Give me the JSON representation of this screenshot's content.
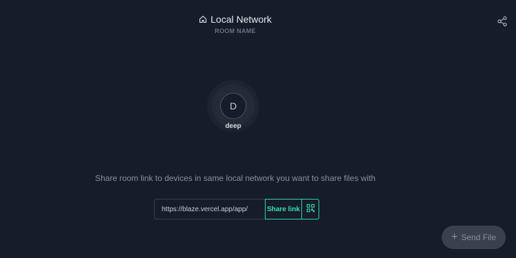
{
  "room": {
    "title": "Local Network",
    "caption": "ROOM NAME",
    "icon": "home-icon"
  },
  "header": {
    "share_icon": "share-icon"
  },
  "peers": [
    {
      "initial": "D",
      "name": "deep"
    }
  ],
  "share": {
    "hint": "Share room link to devices in same local network you want to share files with",
    "link_value": "https://blaze.vercel.app/app/",
    "share_link_label": "Share link",
    "qr_icon": "qr-code-icon"
  },
  "send_file": {
    "label": "Send File",
    "icon": "plus-icon"
  },
  "colors": {
    "background": "#161c29",
    "accent": "#2fd6a5",
    "muted_text": "#8a909c",
    "send_button_bg": "#3b414c"
  }
}
